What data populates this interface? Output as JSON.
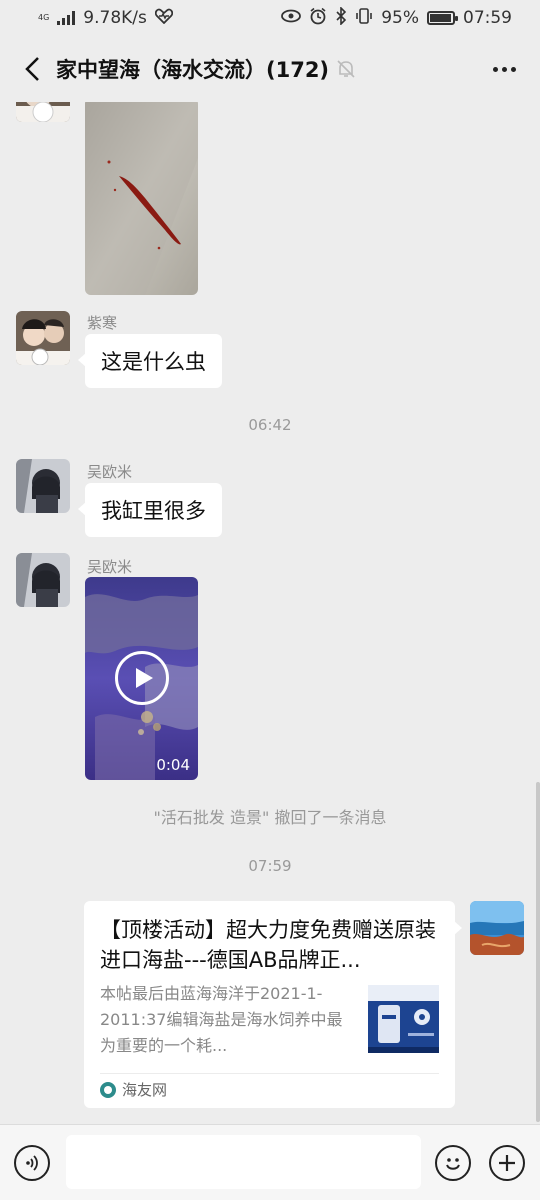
{
  "status_bar": {
    "network_type": "4G",
    "speed": "9.78K/s",
    "battery_pct": "95%",
    "battery_level": 0.95,
    "time": "07:59",
    "icons": [
      "signal-icon",
      "heart-rate-icon",
      "eye-icon",
      "alarm-icon",
      "bluetooth-icon",
      "vibrate-icon",
      "battery-icon"
    ]
  },
  "header": {
    "title": "家中望海（海水交流）(172)",
    "icons": [
      "back-icon",
      "mute-bell-icon",
      "more-icon"
    ]
  },
  "messages": [
    {
      "type": "image",
      "sender": "",
      "content": "red worm on tank glass photo"
    },
    {
      "type": "text",
      "sender": "紫寒",
      "text": "这是什么虫"
    },
    {
      "type": "time",
      "text": "06:42"
    },
    {
      "type": "text",
      "sender": "吴欧米",
      "text": "我缸里很多"
    },
    {
      "type": "video",
      "sender": "吴欧米",
      "duration": "0:04"
    },
    {
      "type": "system",
      "text": "\"活石批发  造景\" 撤回了一条消息"
    },
    {
      "type": "time",
      "text": "07:59"
    },
    {
      "type": "link",
      "sender": "self",
      "title": "【顶楼活动】超大力度免费赠送原装进口海盐---德国AB品牌正...",
      "description": "本帖最后由蓝海海洋于2021-1-2011:37编辑海盐是海水饲养中最为重要的一个耗...",
      "source": "海友网"
    }
  ],
  "input_bar": {
    "placeholder": "",
    "icons": [
      "voice-icon",
      "emoji-icon",
      "plus-icon"
    ]
  }
}
